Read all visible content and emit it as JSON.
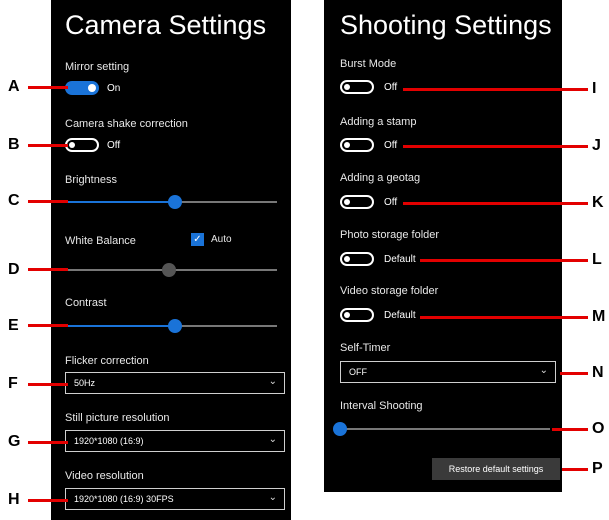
{
  "camera_settings": {
    "title": "Camera Settings",
    "mirror_label": "Mirror setting",
    "mirror_state": "On",
    "shake_label": "Camera shake correction",
    "shake_state": "Off",
    "brightness_label": "Brightness",
    "brightness_value": 0.52,
    "white_balance_label": "White Balance",
    "white_balance_auto_label": "Auto",
    "white_balance_value": 0.49,
    "contrast_label": "Contrast",
    "contrast_value": 0.52,
    "flicker_label": "Flicker correction",
    "flicker_value": "50Hz",
    "still_res_label": "Still picture resolution",
    "still_res_value": "1920*1080 (16:9)",
    "video_res_label": "Video resolution",
    "video_res_value": "1920*1080 (16:9) 30FPS"
  },
  "shooting_settings": {
    "title": "Shooting Settings",
    "burst_label": "Burst Mode",
    "burst_state": "Off",
    "stamp_label": "Adding a stamp",
    "stamp_state": "Off",
    "geotag_label": "Adding a geotag",
    "geotag_state": "Off",
    "photo_folder_label": "Photo storage folder",
    "photo_folder_state": "Default",
    "video_folder_label": "Video storage folder",
    "video_folder_state": "Default",
    "self_timer_label": "Self-Timer",
    "self_timer_value": "OFF",
    "interval_label": "Interval Shooting",
    "interval_value": 0,
    "restore_label": "Restore default settings"
  },
  "callouts": [
    "A",
    "B",
    "C",
    "D",
    "E",
    "F",
    "G",
    "H",
    "I",
    "J",
    "K",
    "L",
    "M",
    "N",
    "O",
    "P"
  ],
  "colors": {
    "accent": "#1a73d8",
    "callout": "#e30000",
    "panel": "#000000"
  },
  "icons": {
    "dropdown": "chevron-down-icon",
    "checkbox": "checkmark-icon"
  }
}
